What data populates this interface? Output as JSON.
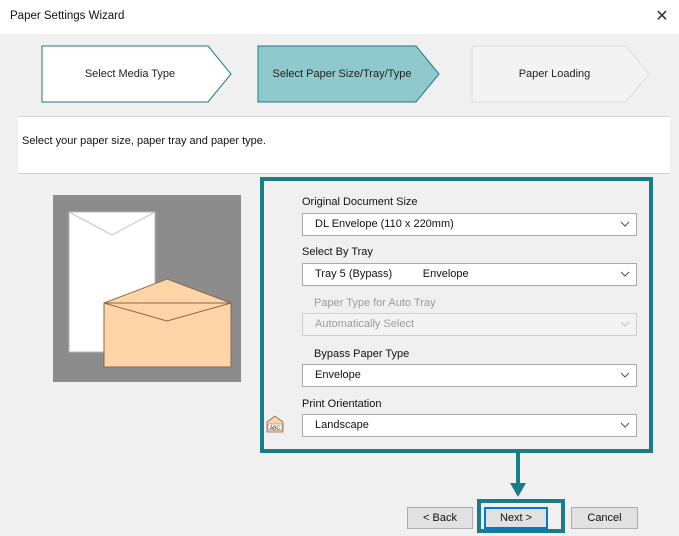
{
  "window": {
    "title": "Paper Settings Wizard",
    "close_glyph": "✕"
  },
  "steps": [
    {
      "label": "Select Media Type",
      "state": "done"
    },
    {
      "label": "Select Paper Size/Tray/Type",
      "state": "active"
    },
    {
      "label": "Paper Loading",
      "state": "pending"
    }
  ],
  "instruction": "Select your paper size, paper tray and paper type.",
  "form": {
    "original_size": {
      "label": "Original Document Size",
      "value": "DL Envelope (110 x 220mm)"
    },
    "select_by_tray": {
      "label": "Select By Tray",
      "value": "Tray 5 (Bypass)          Envelope"
    },
    "auto_tray_type": {
      "label": "Paper Type for Auto Tray",
      "value": "Automatically Select",
      "disabled": true
    },
    "bypass_type": {
      "label": "Bypass Paper Type",
      "value": "Envelope"
    },
    "orientation": {
      "label": "Print Orientation",
      "value": "Landscape",
      "icon": "ABC"
    }
  },
  "buttons": {
    "back": "< Back",
    "next": "Next >",
    "cancel": "Cancel"
  },
  "colors": {
    "accent": "#1b7c86",
    "active_step": "#8fc9cc",
    "envelope_flap": "#fcd4a8"
  }
}
